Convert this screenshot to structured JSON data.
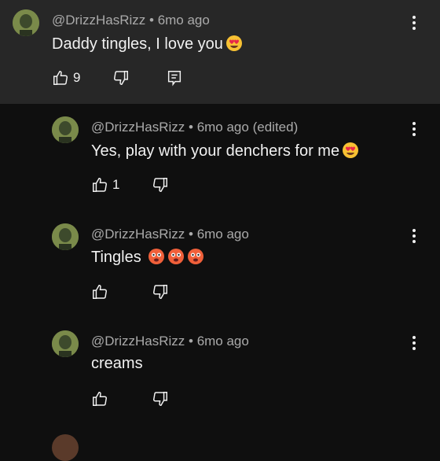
{
  "comments": [
    {
      "author": "@DrizzHasRizz",
      "time": "6mo ago",
      "edited": "",
      "text": "Daddy tingles, I love you",
      "emoji": [
        "heart-eyes"
      ],
      "likes": "9"
    },
    {
      "author": "@DrizzHasRizz",
      "time": "6mo ago",
      "edited": "(edited)",
      "text": "Yes, play with your denchers for me",
      "emoji": [
        "heart-eyes"
      ],
      "likes": "1"
    },
    {
      "author": "@DrizzHasRizz",
      "time": "6mo ago",
      "edited": "",
      "text": "Tingles",
      "emoji": [
        "flushed-hot",
        "flushed-hot",
        "flushed-hot"
      ],
      "likes": ""
    },
    {
      "author": "@DrizzHasRizz",
      "time": "6mo ago",
      "edited": "",
      "text": "creams",
      "emoji": [],
      "likes": ""
    }
  ],
  "separator": "•",
  "icons": {
    "like": "thumbs-up-icon",
    "dislike": "thumbs-down-icon",
    "reply": "reply-icon",
    "more": "more-vertical-icon"
  },
  "colors": {
    "background": "#0f0f0f",
    "parent_highlight": "#272727",
    "meta": "#aaaaaa",
    "text": "#f1f1f1"
  }
}
